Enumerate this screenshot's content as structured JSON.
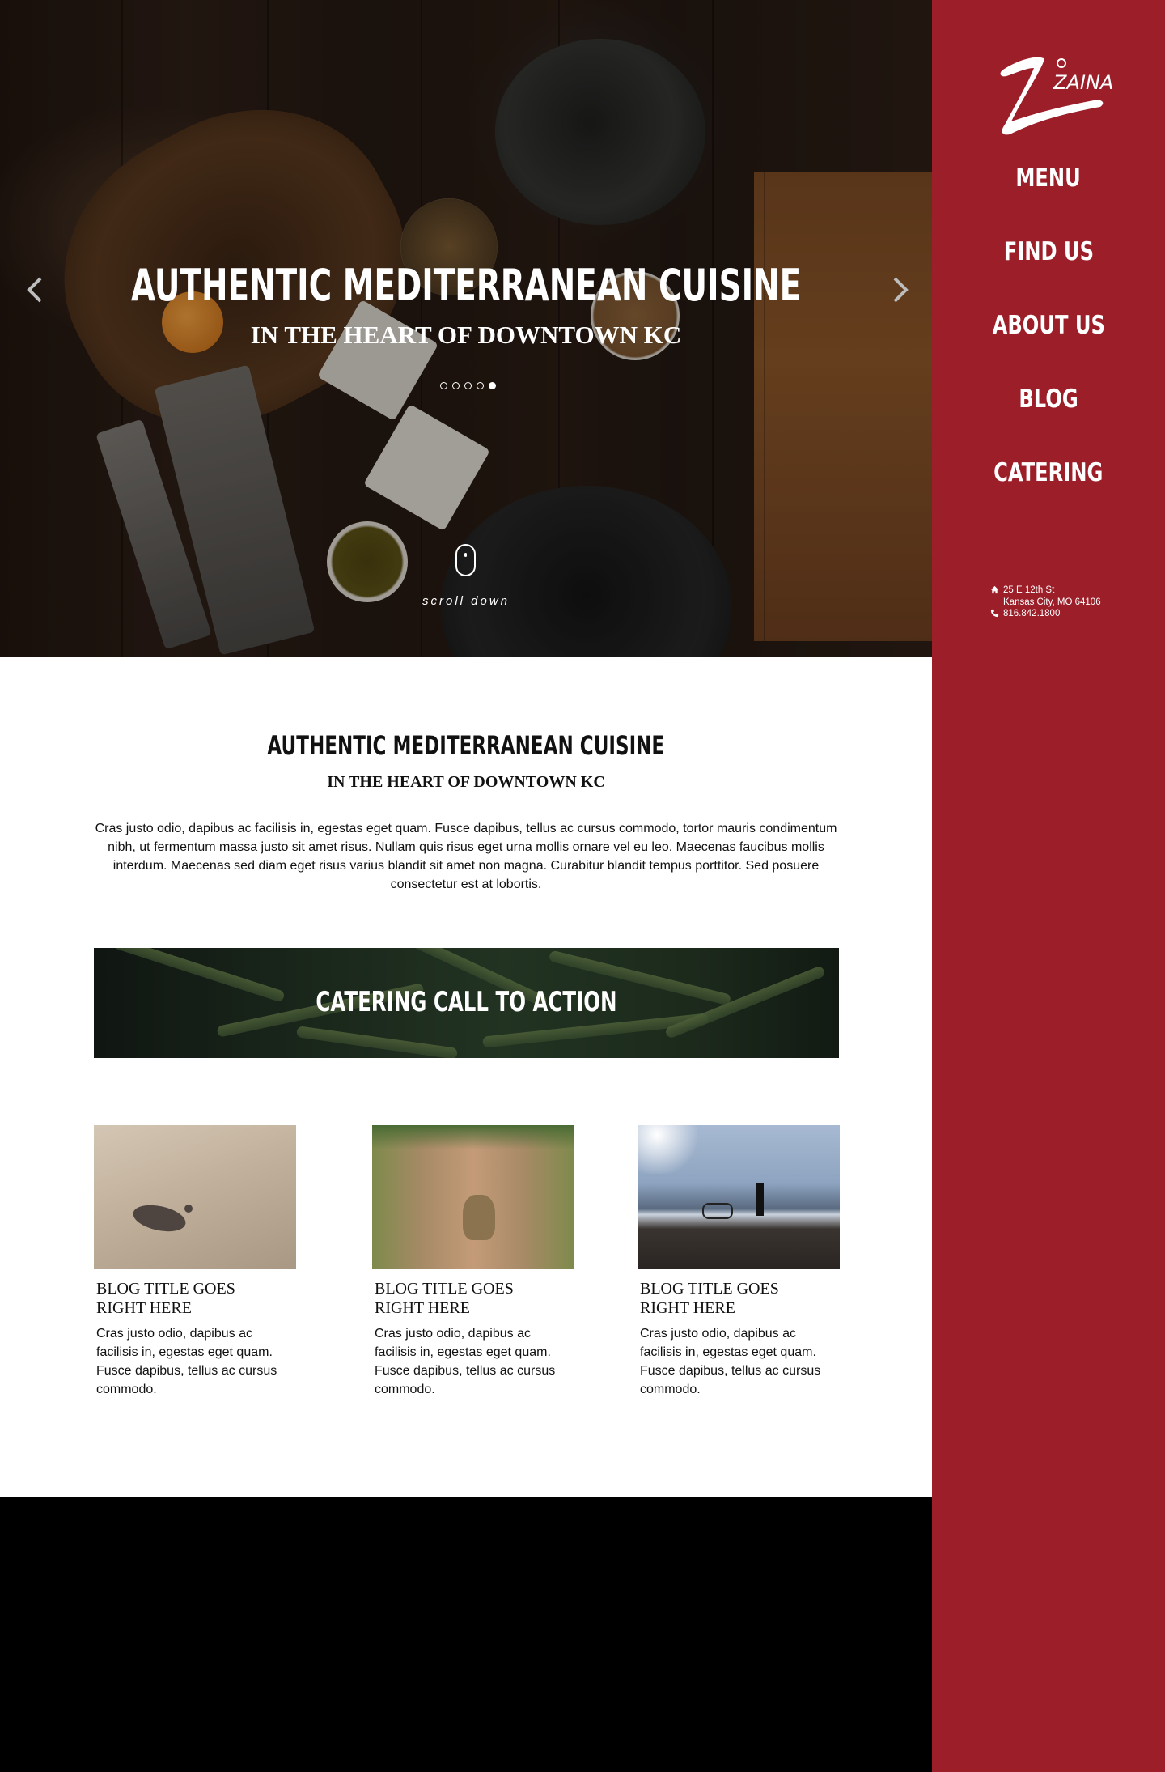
{
  "brand": {
    "logo_text": "ZAINA"
  },
  "nav": {
    "items": [
      {
        "label": "MENU"
      },
      {
        "label": "FIND US"
      },
      {
        "label": "ABOUT US"
      },
      {
        "label": "BLOG"
      },
      {
        "label": "CATERING"
      }
    ]
  },
  "contact": {
    "address_line1": "25 E 12th St",
    "address_line2": "Kansas City, MO 64106",
    "phone": "816.842.1800"
  },
  "hero": {
    "title": "AUTHENTIC MEDITERRANEAN CUISINE",
    "subtitle": "IN THE HEART OF DOWNTOWN KC",
    "slide_count": 5,
    "active_slide": 5,
    "scroll_label": "scroll down"
  },
  "intro": {
    "title": "AUTHENTIC MEDITERRANEAN CUISINE",
    "subtitle": "IN THE HEART OF DOWNTOWN KC",
    "body": "Cras justo odio, dapibus ac facilisis in, egestas eget quam. Fusce dapibus, tellus ac cursus commodo, tortor mauris condimentum nibh, ut fermentum massa justo sit amet risus. Nullam quis risus eget urna mollis ornare vel eu leo. Maecenas faucibus mollis interdum. Maecenas sed diam eget risus varius blandit sit amet non magna. Curabitur blandit tempus porttitor. Sed posuere consectetur est at lobortis."
  },
  "cta": {
    "label": "CATERING CALL TO ACTION"
  },
  "blog": {
    "posts": [
      {
        "title_line1": "BLOG TITLE GOES",
        "title_line2": "RIGHT HERE",
        "excerpt": "Cras justo odio, dapibus ac facilisis in, egestas eget quam. Fusce dapibus, tellus ac cursus commodo."
      },
      {
        "title_line1": "BLOG TITLE GOES",
        "title_line2": "RIGHT HERE",
        "excerpt": "Cras justo odio, dapibus ac facilisis in, egestas eget quam. Fusce dapibus, tellus ac cursus commodo."
      },
      {
        "title_line1": "BLOG TITLE GOES",
        "title_line2": "RIGHT HERE",
        "excerpt": "Cras justo odio, dapibus ac facilisis in, egestas eget quam. Fusce dapibus, tellus ac cursus commodo."
      }
    ]
  },
  "colors": {
    "sidebar": "#9b1e29",
    "footer": "#000000",
    "text": "#111111",
    "text_inverse": "#ffffff"
  },
  "icons": {
    "hero_prev": "chevron-left-icon",
    "hero_next": "chevron-right-icon",
    "scroll": "mouse-icon",
    "address": "home-icon",
    "phone": "phone-icon"
  }
}
